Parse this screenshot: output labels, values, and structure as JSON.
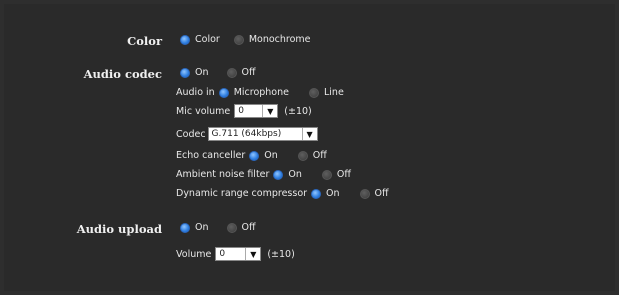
{
  "color": {
    "label": "Color",
    "options": [
      "Color",
      "Monochrome"
    ],
    "selected": "Color"
  },
  "audio_codec": {
    "label": "Audio codec",
    "options": [
      "On",
      "Off"
    ],
    "selected": "On",
    "audio_in": {
      "label": "Audio in",
      "options": [
        "Microphone",
        "Line"
      ],
      "selected": "Microphone"
    },
    "mic_volume": {
      "label": "Mic volume",
      "value": "0",
      "hint": "(±10)"
    },
    "codec": {
      "label": "Codec",
      "value": "G.711 (64kbps)"
    },
    "echo_canceller": {
      "label": "Echo canceller",
      "options": [
        "On",
        "Off"
      ],
      "selected": "On"
    },
    "ambient_noise_filter": {
      "label": "Ambient noise filter",
      "options": [
        "On",
        "Off"
      ],
      "selected": "On"
    },
    "dynamic_range_compressor": {
      "label": "Dynamic range compressor",
      "options": [
        "On",
        "Off"
      ],
      "selected": "On"
    }
  },
  "audio_upload": {
    "label": "Audio upload",
    "options": [
      "On",
      "Off"
    ],
    "selected": "On",
    "volume": {
      "label": "Volume",
      "value": "0",
      "hint": "(±10)"
    }
  },
  "icons": {
    "dropdown": "▼"
  },
  "colors": {
    "accent": "#2f7fe0",
    "background": "#2a2a2a"
  }
}
